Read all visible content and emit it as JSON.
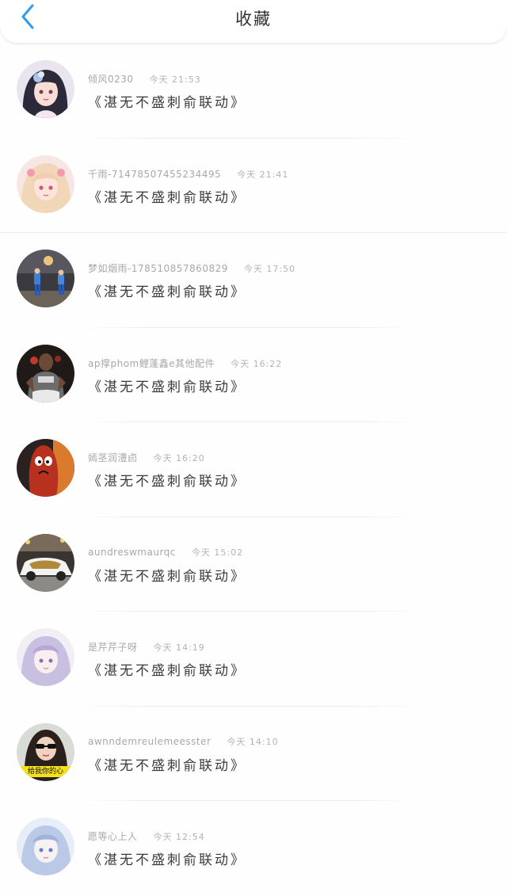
{
  "header": {
    "title": "收藏",
    "accent_color": "#2d9bf0"
  },
  "items": [
    {
      "name": "倾风0230",
      "time": "今天 21:53",
      "message": "《湛无不盛刺俞联动》",
      "avatar": "anime-girl-dark-hair"
    },
    {
      "name": "千雨-71478507455234495",
      "time": "今天 21:41",
      "message": "《湛无不盛刺俞联动》",
      "avatar": "anime-girl-pink"
    },
    {
      "name": "梦如烟雨-178510857860829",
      "time": "今天 17:50",
      "message": "《湛无不盛刺俞联动》",
      "avatar": "street-photo"
    },
    {
      "name": "ap撑phom鲤蓬鑫e其他配件",
      "time": "今天 16:22",
      "message": "《湛无不盛刺俞联动》",
      "avatar": "man-in-jersey"
    },
    {
      "name": "嫣茎润澧卣",
      "time": "今天 16:20",
      "message": "《湛无不盛刺俞联动》",
      "avatar": "cartoon-face"
    },
    {
      "name": "aundreswmaurqc",
      "time": "今天 15:02",
      "message": "《湛无不盛刺俞联动》",
      "avatar": "white-car"
    },
    {
      "name": "是芹芹子呀",
      "time": "今天 14:19",
      "message": "《湛无不盛刺俞联动》",
      "avatar": "anime-girl-purple"
    },
    {
      "name": "awnndemreulemeesster",
      "time": "今天 14:10",
      "message": "《湛无不盛刺俞联动》",
      "avatar": "girl-sunglasses",
      "avatar_text": "给我你的心"
    },
    {
      "name": "愿等心上人",
      "time": "今天 12:54",
      "message": "《湛无不盛刺俞联动》",
      "avatar": "anime-girl-blue"
    }
  ]
}
